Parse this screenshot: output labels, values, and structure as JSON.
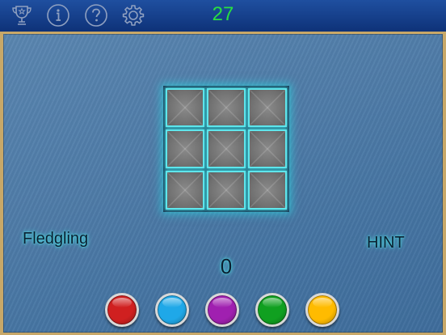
{
  "header": {
    "level_counter": "27",
    "icons": [
      "trophy-icon",
      "info-icon",
      "help-icon",
      "settings-icon"
    ]
  },
  "game": {
    "grid_rows": 3,
    "grid_cols": 3,
    "tile_color": "#6f6f6f",
    "tile_glow": "#5fe6ec",
    "rank_label": "Fledgling",
    "hint_label": "HINT",
    "score": "0"
  },
  "colors": [
    {
      "name": "red",
      "hex": "#d02020"
    },
    {
      "name": "blue",
      "hex": "#1fa8e8"
    },
    {
      "name": "purple",
      "hex": "#a020b0"
    },
    {
      "name": "green",
      "hex": "#10a020"
    },
    {
      "name": "yellow",
      "hex": "#ffbb00"
    }
  ]
}
